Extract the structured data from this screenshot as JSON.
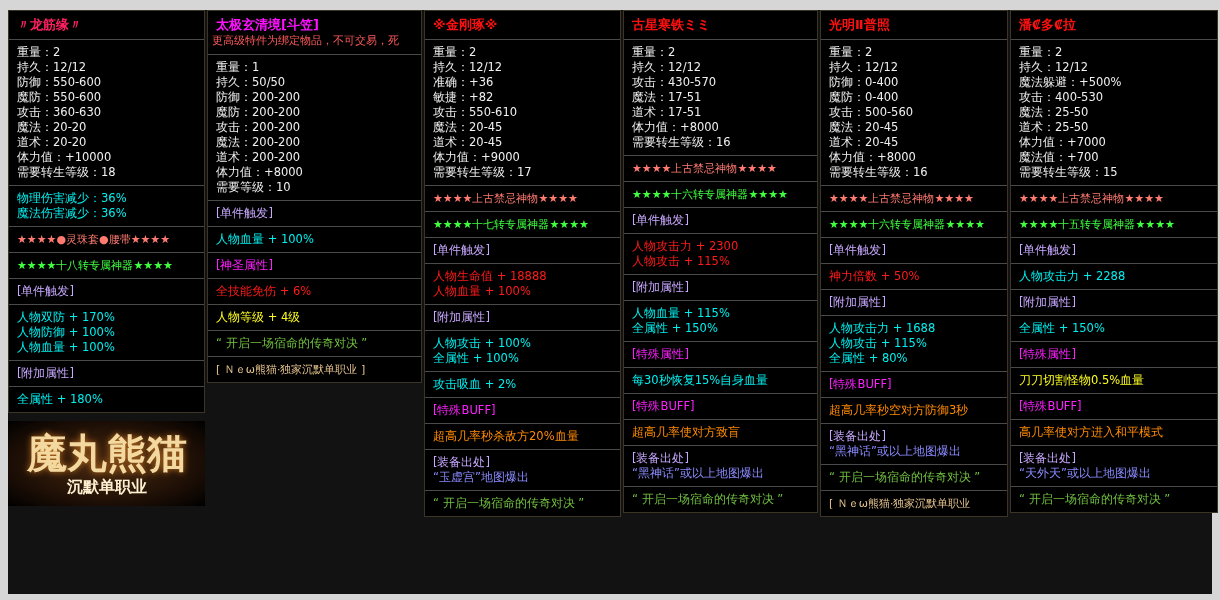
{
  "tooltips": [
    {
      "title": "〃龙筋缘〃",
      "kind": "rose",
      "sections": [
        {
          "lines": [
            {
              "kind": "stat",
              "text": "重量：2"
            },
            {
              "kind": "stat",
              "text": "持久：12/12"
            },
            {
              "kind": "stat",
              "text": "防御：550-600"
            },
            {
              "kind": "stat",
              "text": "魔防：550-600"
            },
            {
              "kind": "stat",
              "text": "攻击：360-630"
            },
            {
              "kind": "stat",
              "text": "魔法：20-20"
            },
            {
              "kind": "stat",
              "text": "道术：20-20"
            },
            {
              "kind": "stat",
              "text": "体力值：+10000"
            },
            {
              "kind": "stat",
              "text": "需要转生等级：18"
            }
          ]
        },
        {
          "lines": [
            {
              "kind": "cyan",
              "text": "物理伤害减少：36%"
            },
            {
              "kind": "cyan",
              "text": "魔法伤害减少：36%"
            }
          ]
        },
        {
          "lines": [
            {
              "kind": "rank",
              "text": "★★★★●灵珠套●腰带★★★★"
            }
          ]
        },
        {
          "lines": [
            {
              "kind": "tier",
              "text": "★★★★十八转专属神器★★★★"
            }
          ]
        },
        {
          "lines": [
            {
              "kind": "header",
              "text": "[单件触发]"
            }
          ]
        },
        {
          "lines": [
            {
              "kind": "cyan",
              "text": "人物双防 + 170%"
            },
            {
              "kind": "cyan",
              "text": "人物防御 + 100%"
            },
            {
              "kind": "cyan",
              "text": "人物血量 + 100%"
            }
          ]
        },
        {
          "lines": [
            {
              "kind": "header",
              "text": "[附加属性]"
            }
          ]
        },
        {
          "lines": [
            {
              "kind": "cyan",
              "text": "全属性 + 180%"
            }
          ]
        }
      ]
    },
    {
      "title": "太极玄清境[斗笠]",
      "kind": "magenta",
      "subtitle": "更高级特件为绑定物品，不可交易，死",
      "sections": [
        {
          "lines": [
            {
              "kind": "stat",
              "text": "重量：1"
            },
            {
              "kind": "stat",
              "text": "持久：50/50"
            },
            {
              "kind": "stat",
              "text": "防御：200-200"
            },
            {
              "kind": "stat",
              "text": "魔防：200-200"
            },
            {
              "kind": "stat",
              "text": "攻击：200-200"
            },
            {
              "kind": "stat",
              "text": "魔法：200-200"
            },
            {
              "kind": "stat",
              "text": "道术：200-200"
            },
            {
              "kind": "stat",
              "text": "体力值：+8000"
            },
            {
              "kind": "stat",
              "text": "需要等级：10"
            }
          ]
        },
        {
          "lines": [
            {
              "kind": "header",
              "text": "[单件触发]"
            }
          ]
        },
        {
          "lines": [
            {
              "kind": "cyan",
              "text": "人物血量 + 100%"
            }
          ]
        },
        {
          "lines": [
            {
              "kind": "special",
              "text": "[神圣属性]"
            }
          ]
        },
        {
          "lines": [
            {
              "kind": "red",
              "text": "全技能免伤 + 6%"
            }
          ]
        },
        {
          "lines": [
            {
              "kind": "yellow",
              "text": "人物等级 + 4级"
            }
          ]
        },
        {
          "lines": [
            {
              "kind": "quote",
              "text": "“   开启一场宿命的传奇对决   ”"
            }
          ]
        },
        {
          "lines": [
            {
              "kind": "credit",
              "text": "[  Ｎｅω熊猫·独家沉默单职业  ]"
            }
          ]
        }
      ]
    },
    {
      "title": "※金刚琢※",
      "kind": "red",
      "sections": [
        {
          "lines": [
            {
              "kind": "stat",
              "text": "重量：2"
            },
            {
              "kind": "stat",
              "text": "持久：12/12"
            },
            {
              "kind": "stat",
              "text": "准确：+36"
            },
            {
              "kind": "stat",
              "text": "敏捷：+82"
            },
            {
              "kind": "stat",
              "text": "攻击：550-610"
            },
            {
              "kind": "stat",
              "text": "魔法：20-45"
            },
            {
              "kind": "stat",
              "text": "道术：20-45"
            },
            {
              "kind": "stat",
              "text": "体力值：+9000"
            },
            {
              "kind": "stat",
              "text": "需要转生等级：17"
            }
          ]
        },
        {
          "lines": [
            {
              "kind": "rank",
              "text": "★★★★上古禁忌神物★★★★"
            }
          ]
        },
        {
          "lines": [
            {
              "kind": "tier",
              "text": "★★★★十七转专属神器★★★★"
            }
          ]
        },
        {
          "lines": [
            {
              "kind": "header",
              "text": "[单件触发]"
            }
          ]
        },
        {
          "lines": [
            {
              "kind": "red",
              "text": "人物生命值 + 18888"
            },
            {
              "kind": "red",
              "text": "人物血量 + 100%"
            }
          ]
        },
        {
          "lines": [
            {
              "kind": "header",
              "text": "[附加属性]"
            }
          ]
        },
        {
          "lines": [
            {
              "kind": "cyan",
              "text": "人物攻击 + 100%"
            },
            {
              "kind": "cyan",
              "text": "全属性 + 100%"
            }
          ]
        },
        {
          "lines": [
            {
              "kind": "cyan",
              "text": "攻击吸血 + 2%"
            }
          ]
        },
        {
          "lines": [
            {
              "kind": "special",
              "text": "[特殊BUFF]"
            }
          ]
        },
        {
          "lines": [
            {
              "kind": "orange",
              "text": "超高几率秒杀敌方20%血量"
            }
          ]
        },
        {
          "lines": [
            {
              "kind": "header",
              "text": "[装备出处]"
            },
            {
              "kind": "source",
              "text": "“玉虚宫”地图爆出"
            }
          ]
        },
        {
          "lines": [
            {
              "kind": "quote",
              "text": "“   开启一场宿命的传奇对决   ”"
            }
          ]
        }
      ]
    },
    {
      "title": "古星寒铁ミミ",
      "kind": "red",
      "sections": [
        {
          "lines": [
            {
              "kind": "stat",
              "text": "重量：2"
            },
            {
              "kind": "stat",
              "text": "持久：12/12"
            },
            {
              "kind": "stat",
              "text": "攻击：430-570"
            },
            {
              "kind": "stat",
              "text": "魔法：17-51"
            },
            {
              "kind": "stat",
              "text": "道术：17-51"
            },
            {
              "kind": "stat",
              "text": "体力值：+8000"
            },
            {
              "kind": "stat",
              "text": "需要转生等级：16"
            }
          ]
        },
        {
          "lines": [
            {
              "kind": "rank",
              "text": "★★★★上古禁忌神物★★★★"
            }
          ]
        },
        {
          "lines": [
            {
              "kind": "tier",
              "text": "★★★★十六转专属神器★★★★"
            }
          ]
        },
        {
          "lines": [
            {
              "kind": "header",
              "text": "[单件触发]"
            }
          ]
        },
        {
          "lines": [
            {
              "kind": "red",
              "text": "人物攻击力 + 2300"
            },
            {
              "kind": "red",
              "text": "人物攻击 + 115%"
            }
          ]
        },
        {
          "lines": [
            {
              "kind": "header",
              "text": "[附加属性]"
            }
          ]
        },
        {
          "lines": [
            {
              "kind": "cyan",
              "text": "人物血量 + 115%"
            },
            {
              "kind": "cyan",
              "text": "全属性 + 150%"
            }
          ]
        },
        {
          "lines": [
            {
              "kind": "special",
              "text": "[特殊属性]"
            }
          ]
        },
        {
          "lines": [
            {
              "kind": "cyan",
              "text": "每30秒恢复15%自身血量"
            }
          ]
        },
        {
          "lines": [
            {
              "kind": "special",
              "text": "[特殊BUFF]"
            }
          ]
        },
        {
          "lines": [
            {
              "kind": "orange",
              "text": "超高几率使对方致盲"
            }
          ]
        },
        {
          "lines": [
            {
              "kind": "header",
              "text": "[装备出处]"
            },
            {
              "kind": "source",
              "text": "“黑神话”或以上地图爆出"
            }
          ]
        },
        {
          "lines": [
            {
              "kind": "quote",
              "text": "“   开启一场宿命的传奇对决   ”"
            }
          ]
        }
      ]
    },
    {
      "title": "光明Ⅱ普照",
      "kind": "red",
      "sections": [
        {
          "lines": [
            {
              "kind": "stat",
              "text": "重量：2"
            },
            {
              "kind": "stat",
              "text": "持久：12/12"
            },
            {
              "kind": "stat",
              "text": "防御：0-400"
            },
            {
              "kind": "stat",
              "text": "魔防：0-400"
            },
            {
              "kind": "stat",
              "text": "攻击：500-560"
            },
            {
              "kind": "stat",
              "text": "魔法：20-45"
            },
            {
              "kind": "stat",
              "text": "道术：20-45"
            },
            {
              "kind": "stat",
              "text": "体力值：+8000"
            },
            {
              "kind": "stat",
              "text": "需要转生等级：16"
            }
          ]
        },
        {
          "lines": [
            {
              "kind": "rank",
              "text": "★★★★上古禁忌神物★★★★"
            }
          ]
        },
        {
          "lines": [
            {
              "kind": "tier",
              "text": "★★★★十六转专属神器★★★★"
            }
          ]
        },
        {
          "lines": [
            {
              "kind": "header",
              "text": "[单件触发]"
            }
          ]
        },
        {
          "lines": [
            {
              "kind": "red",
              "text": "神力倍数 + 50%"
            }
          ]
        },
        {
          "lines": [
            {
              "kind": "header",
              "text": "[附加属性]"
            }
          ]
        },
        {
          "lines": [
            {
              "kind": "cyan",
              "text": "人物攻击力 + 1688"
            },
            {
              "kind": "cyan",
              "text": "人物攻击 + 115%"
            },
            {
              "kind": "cyan",
              "text": "全属性 + 80%"
            }
          ]
        },
        {
          "lines": [
            {
              "kind": "special",
              "text": "[特殊BUFF]"
            }
          ]
        },
        {
          "lines": [
            {
              "kind": "orange",
              "text": "超高几率秒空对方防御3秒"
            }
          ]
        },
        {
          "lines": [
            {
              "kind": "header",
              "text": "[装备出处]"
            },
            {
              "kind": "source",
              "text": "“黑神话”或以上地图爆出"
            }
          ]
        },
        {
          "lines": [
            {
              "kind": "quote",
              "text": "“   开启一场宿命的传奇对决   ”"
            }
          ]
        },
        {
          "lines": [
            {
              "kind": "credit",
              "text": "[  Ｎｅω熊猫·独家沉默单职业"
            }
          ]
        }
      ]
    },
    {
      "title": "潘₡多₡拉",
      "kind": "red",
      "sections": [
        {
          "lines": [
            {
              "kind": "stat",
              "text": "重量：2"
            },
            {
              "kind": "stat",
              "text": "持久：12/12"
            },
            {
              "kind": "stat",
              "text": "魔法躲避：+500%"
            },
            {
              "kind": "stat",
              "text": "攻击：400-530"
            },
            {
              "kind": "stat",
              "text": "魔法：25-50"
            },
            {
              "kind": "stat",
              "text": "道术：25-50"
            },
            {
              "kind": "stat",
              "text": "体力值：+7000"
            },
            {
              "kind": "stat",
              "text": "魔法值：+700"
            },
            {
              "kind": "stat",
              "text": "需要转生等级：15"
            }
          ]
        },
        {
          "lines": [
            {
              "kind": "rank",
              "text": "★★★★上古禁忌神物★★★★"
            }
          ]
        },
        {
          "lines": [
            {
              "kind": "tier",
              "text": "★★★★十五转专属神器★★★★"
            }
          ]
        },
        {
          "lines": [
            {
              "kind": "header",
              "text": "[单件触发]"
            }
          ]
        },
        {
          "lines": [
            {
              "kind": "cyan",
              "text": "人物攻击力 + 2288"
            }
          ]
        },
        {
          "lines": [
            {
              "kind": "header",
              "text": "[附加属性]"
            }
          ]
        },
        {
          "lines": [
            {
              "kind": "cyan",
              "text": "全属性 + 150%"
            }
          ]
        },
        {
          "lines": [
            {
              "kind": "special",
              "text": "[特殊属性]"
            }
          ]
        },
        {
          "lines": [
            {
              "kind": "yellow",
              "text": "刀刀切割怪物0.5%血量"
            }
          ]
        },
        {
          "lines": [
            {
              "kind": "special",
              "text": "[特殊BUFF]"
            }
          ]
        },
        {
          "lines": [
            {
              "kind": "orange",
              "text": "高几率使对方进入和平模式"
            }
          ]
        },
        {
          "lines": [
            {
              "kind": "header",
              "text": "[装备出处]"
            },
            {
              "kind": "source",
              "text": "“天外天”或以上地图爆出"
            }
          ]
        },
        {
          "lines": [
            {
              "kind": "quote",
              "text": "“   开启一场宿命的传奇对决   ”"
            }
          ]
        }
      ]
    }
  ],
  "logo": {
    "title": "魔丸熊猫",
    "subtitle": "沉默单职业"
  }
}
